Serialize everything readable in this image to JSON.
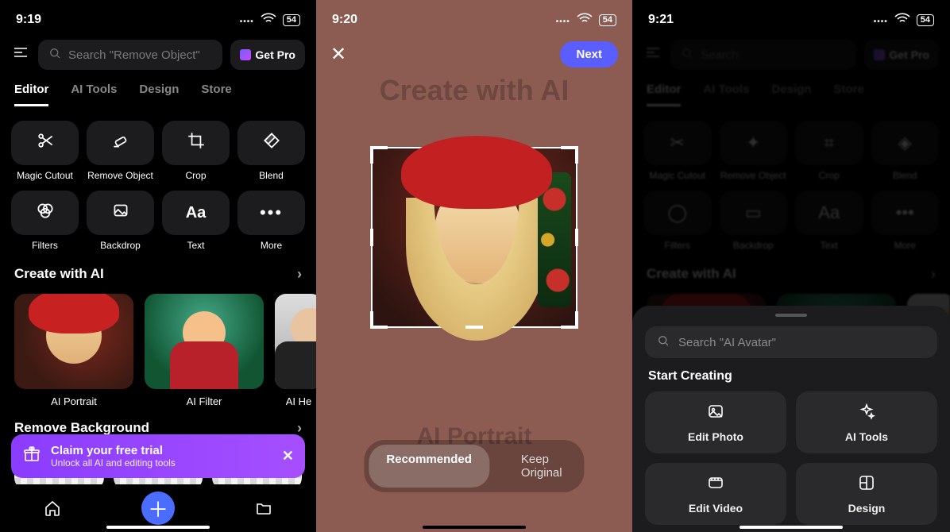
{
  "status": {
    "time1": "9:19",
    "time2": "9:20",
    "time3": "9:21",
    "battery": "54"
  },
  "screen1": {
    "search_placeholder": "Search \"Remove Object\"",
    "get_pro": "Get Pro",
    "tabs": {
      "editor": "Editor",
      "ai_tools": "AI Tools",
      "design": "Design",
      "store": "Store"
    },
    "tools": {
      "magic_cutout": "Magic Cutout",
      "remove_object": "Remove Object",
      "crop": "Crop",
      "blend": "Blend",
      "filters": "Filters",
      "backdrop": "Backdrop",
      "text": "Text",
      "text_glyph": "Aa",
      "more": "More",
      "more_glyph": "•••"
    },
    "create_ai_title": "Create with AI",
    "cards": {
      "portrait": "AI Portrait",
      "filter": "AI Filter",
      "headshot": "AI He"
    },
    "remove_bg_title": "Remove Background",
    "banner": {
      "title": "Claim your free trial",
      "subtitle": "Unlock all AI and editing tools"
    }
  },
  "screen2": {
    "next": "Next",
    "ghost_top": "Create with AI",
    "ghost_label": "AI Portrait",
    "seg_recommended": "Recommended",
    "seg_keep": "Keep Original"
  },
  "screen3": {
    "search_placeholder": "Search \"AI Avatar\"",
    "title": "Start Creating",
    "cards": {
      "edit_photo": "Edit Photo",
      "ai_tools": "AI Tools",
      "edit_video": "Edit Video",
      "design": "Design"
    }
  }
}
